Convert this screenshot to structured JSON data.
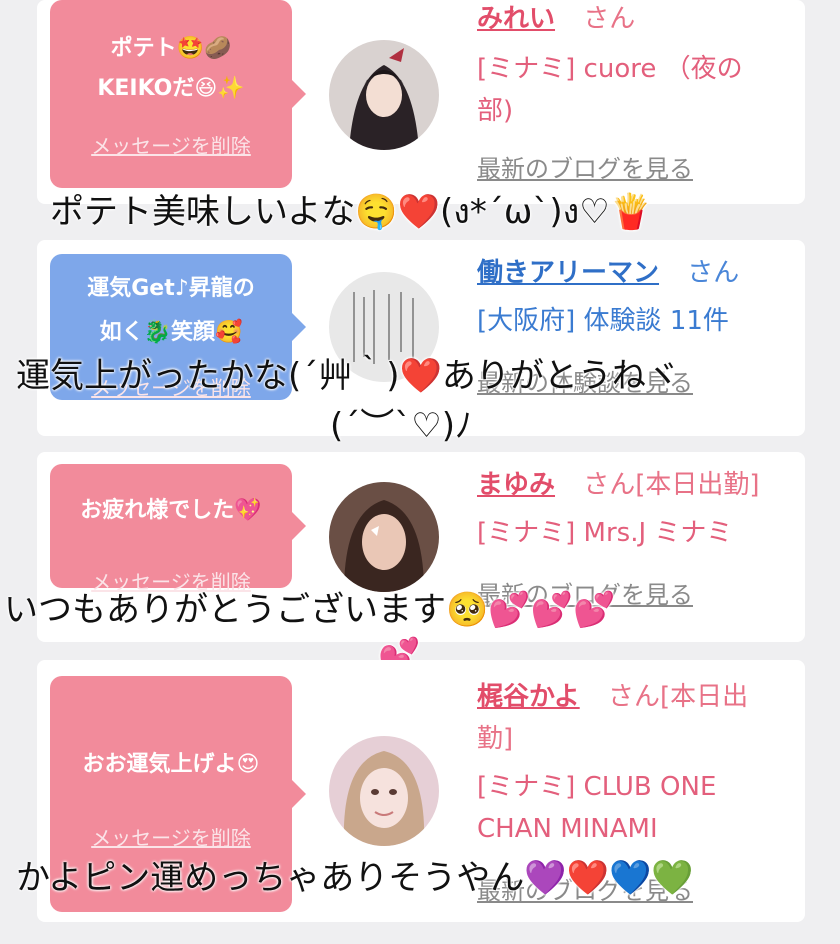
{
  "cards": [
    {
      "bubble_lines": [
        "ポテト🤩🥔",
        "KEIKOだ😆✨"
      ],
      "delete_label": "メッセージを削除",
      "name": "みれい",
      "honorific": "さん",
      "shop": "[ミナミ] cuore （夜の部)",
      "blog_label": "最新のブログを見る",
      "caption": "ポテト美味しいよな🤤❤️(ง*´ω`)ง♡🍟"
    },
    {
      "bubble_lines": [
        "運気Get♪昇龍の",
        "如く🐉笑顔🥰"
      ],
      "delete_label": "メッセージを削除",
      "name": "働きアリーマン",
      "honorific": "さん",
      "shop": "[大阪府] 体験談 11件",
      "blog_label": "最新の体験談を見る",
      "caption_line1": "運気上がったかな(´艸｀)❤️ありがとうねヾ",
      "caption_line2": "(´︶`♡)ﾉ"
    },
    {
      "bubble_lines": [
        "お疲れ様でした💖"
      ],
      "delete_label": "メッセージを削除",
      "name": "まゆみ",
      "honorific": "さん[本日出勤]",
      "shop": "[ミナミ] Mrs.J ミナミ",
      "blog_label": "最新のブログを見る",
      "caption_line1": "いつもありがとうございます🥺💕💕💕",
      "caption_line2": "💕"
    },
    {
      "bubble_lines": [
        "おお運気上げよ😍"
      ],
      "delete_label": "メッセージを削除",
      "name": "梶谷かよ",
      "honorific_line1": "さん[本日出",
      "honorific_line2": "勤]",
      "shop_line1": "[ミナミ] CLUB ONE",
      "shop_line2": "CHAN MINAMI",
      "blog_label": "最新のブログを見る",
      "caption": "かよピン運めっちゃありそうやん💜❤️💙💚"
    }
  ]
}
